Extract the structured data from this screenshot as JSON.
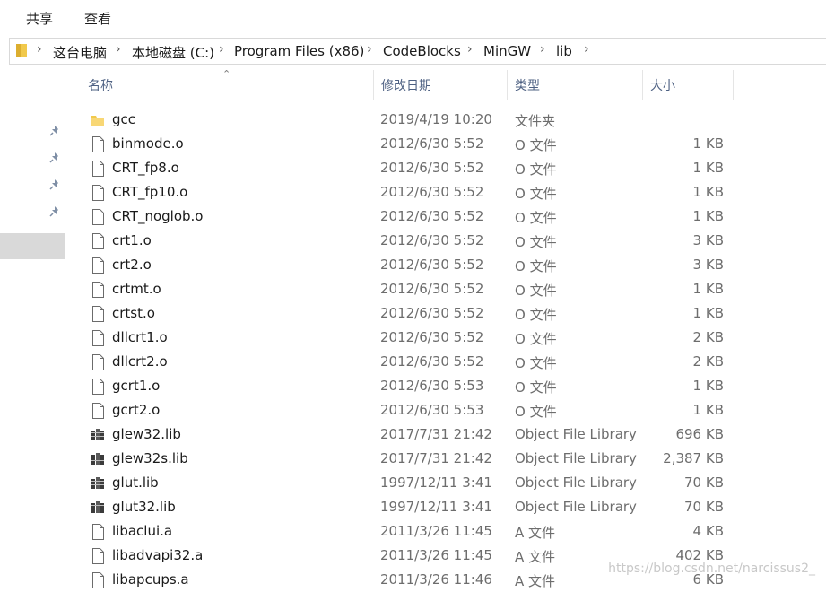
{
  "ribbon": {
    "tabs": [
      {
        "label": "共享"
      },
      {
        "label": "查看"
      }
    ]
  },
  "breadcrumb": {
    "items": [
      {
        "label": "这台电脑"
      },
      {
        "label": "本地磁盘 (C:)"
      },
      {
        "label": "Program Files (x86)"
      },
      {
        "label": "CodeBlocks"
      },
      {
        "label": "MinGW"
      },
      {
        "label": "lib"
      }
    ],
    "separator": "›"
  },
  "columns": {
    "name": "名称",
    "date": "修改日期",
    "type": "类型",
    "size": "大小"
  },
  "files": [
    {
      "name": "gcc",
      "date": "2019/4/19 10:20",
      "type": "文件夹",
      "size": "",
      "icon": "folder-icon"
    },
    {
      "name": "binmode.o",
      "date": "2012/6/30 5:52",
      "type": "O 文件",
      "size": "1 KB",
      "icon": "file-icon"
    },
    {
      "name": "CRT_fp8.o",
      "date": "2012/6/30 5:52",
      "type": "O 文件",
      "size": "1 KB",
      "icon": "file-icon"
    },
    {
      "name": "CRT_fp10.o",
      "date": "2012/6/30 5:52",
      "type": "O 文件",
      "size": "1 KB",
      "icon": "file-icon"
    },
    {
      "name": "CRT_noglob.o",
      "date": "2012/6/30 5:52",
      "type": "O 文件",
      "size": "1 KB",
      "icon": "file-icon"
    },
    {
      "name": "crt1.o",
      "date": "2012/6/30 5:52",
      "type": "O 文件",
      "size": "3 KB",
      "icon": "file-icon"
    },
    {
      "name": "crt2.o",
      "date": "2012/6/30 5:52",
      "type": "O 文件",
      "size": "3 KB",
      "icon": "file-icon"
    },
    {
      "name": "crtmt.o",
      "date": "2012/6/30 5:52",
      "type": "O 文件",
      "size": "1 KB",
      "icon": "file-icon"
    },
    {
      "name": "crtst.o",
      "date": "2012/6/30 5:52",
      "type": "O 文件",
      "size": "1 KB",
      "icon": "file-icon"
    },
    {
      "name": "dllcrt1.o",
      "date": "2012/6/30 5:52",
      "type": "O 文件",
      "size": "2 KB",
      "icon": "file-icon"
    },
    {
      "name": "dllcrt2.o",
      "date": "2012/6/30 5:52",
      "type": "O 文件",
      "size": "2 KB",
      "icon": "file-icon"
    },
    {
      "name": "gcrt1.o",
      "date": "2012/6/30 5:53",
      "type": "O 文件",
      "size": "1 KB",
      "icon": "file-icon"
    },
    {
      "name": "gcrt2.o",
      "date": "2012/6/30 5:53",
      "type": "O 文件",
      "size": "1 KB",
      "icon": "file-icon"
    },
    {
      "name": "glew32.lib",
      "date": "2017/7/31 21:42",
      "type": "Object File Library",
      "size": "696 KB",
      "icon": "library-icon"
    },
    {
      "name": "glew32s.lib",
      "date": "2017/7/31 21:42",
      "type": "Object File Library",
      "size": "2,387 KB",
      "icon": "library-icon"
    },
    {
      "name": "glut.lib",
      "date": "1997/12/11 3:41",
      "type": "Object File Library",
      "size": "70 KB",
      "icon": "library-icon"
    },
    {
      "name": "glut32.lib",
      "date": "1997/12/11 3:41",
      "type": "Object File Library",
      "size": "70 KB",
      "icon": "library-icon"
    },
    {
      "name": "libaclui.a",
      "date": "2011/3/26 11:45",
      "type": "A 文件",
      "size": "4 KB",
      "icon": "file-icon"
    },
    {
      "name": "libadvapi32.a",
      "date": "2011/3/26 11:45",
      "type": "A 文件",
      "size": "402 KB",
      "icon": "file-icon"
    },
    {
      "name": "libapcups.a",
      "date": "2011/3/26 11:46",
      "type": "A 文件",
      "size": "6 KB",
      "icon": "file-icon"
    }
  ],
  "watermark": "https://blog.csdn.net/narcissus2_",
  "colors": {
    "header_text": "#4d6082",
    "secondary_text": "#6d6d6d",
    "folder": "#f1c94c"
  }
}
